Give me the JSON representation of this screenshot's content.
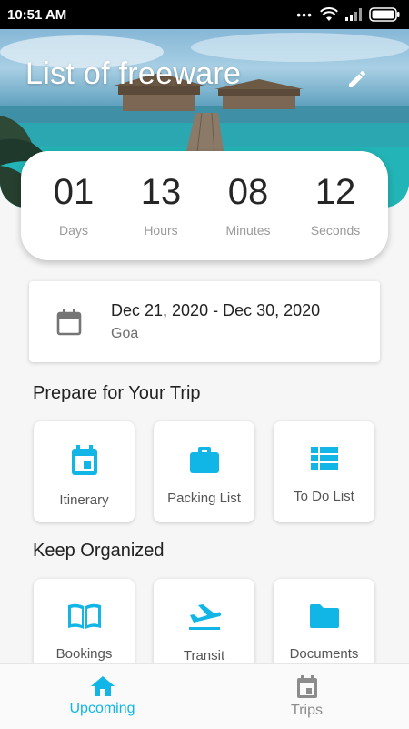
{
  "status_bar": {
    "time": "10:51 AM"
  },
  "header": {
    "title": "List of freeware",
    "edit_icon": "pencil-icon"
  },
  "countdown": [
    {
      "value": "01",
      "label": "Days"
    },
    {
      "value": "13",
      "label": "Hours"
    },
    {
      "value": "08",
      "label": "Minutes"
    },
    {
      "value": "12",
      "label": "Seconds"
    }
  ],
  "trip": {
    "date_range": "Dec 21, 2020 - Dec 30, 2020",
    "location": "Goa",
    "icon": "calendar-icon"
  },
  "sections": [
    {
      "title": "Prepare for Your Trip",
      "items": [
        {
          "label": "Itinerary",
          "icon": "event-calendar-icon"
        },
        {
          "label": "Packing List",
          "icon": "briefcase-icon"
        },
        {
          "label": "To Do List",
          "icon": "list-icon"
        }
      ]
    },
    {
      "title": "Keep Organized",
      "items": [
        {
          "label": "Bookings",
          "icon": "book-icon"
        },
        {
          "label": "Transit",
          "icon": "airplane-takeoff-icon"
        },
        {
          "label": "Documents",
          "icon": "folder-icon"
        }
      ]
    }
  ],
  "bottom_nav": [
    {
      "label": "Upcoming",
      "icon": "home-icon",
      "active": true
    },
    {
      "label": "Trips",
      "icon": "calendar-icon",
      "active": false
    }
  ],
  "colors": {
    "accent": "#12b6e6",
    "inactive": "#8c8c8c"
  }
}
